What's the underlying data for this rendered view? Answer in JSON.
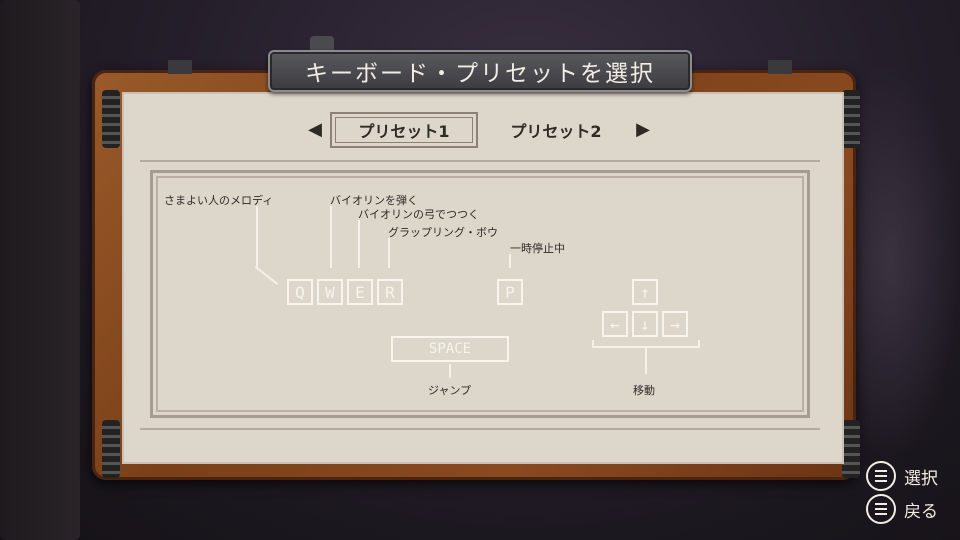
{
  "title": "キーボード・プリセットを選択",
  "presets": {
    "active": "プリセット1",
    "inactive": "プリセット2"
  },
  "labels": {
    "q": "さまよい人のメロディ",
    "w": "バイオリンを弾く",
    "e": "バイオリンの弓でつつく",
    "r": "グラップリング・ボウ",
    "p": "一時停止中",
    "space": "ジャンプ",
    "arrows": "移動"
  },
  "keys": {
    "q": "Q",
    "w": "W",
    "e": "E",
    "r": "R",
    "p": "P",
    "space": "SPACE",
    "up": "↑",
    "left": "←",
    "down": "↓",
    "right": "→"
  },
  "hints": {
    "select": "選択",
    "back": "戻る"
  },
  "colors": {
    "parchment": "#dcd6cb",
    "wood": "#8a4a20",
    "key_outline": "#f7f4ee",
    "text": "#2e2a26"
  }
}
